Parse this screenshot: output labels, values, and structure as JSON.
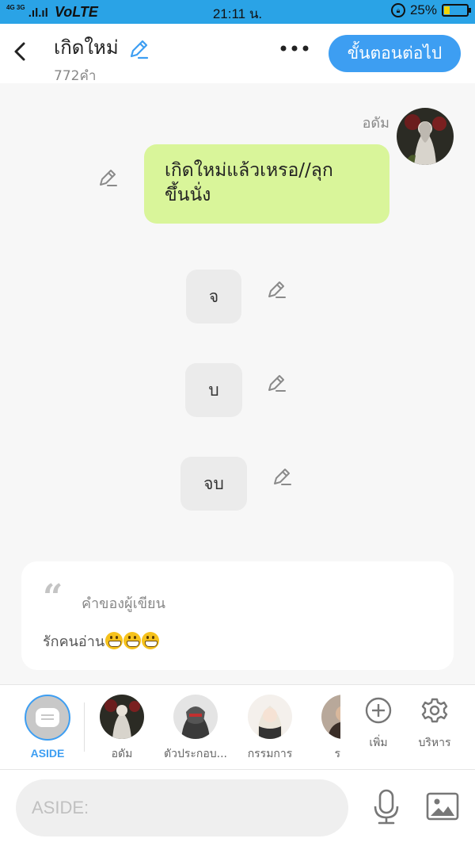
{
  "status_bar": {
    "network": "4G 3G",
    "carrier": "VoLTE",
    "time": "21:11 น.",
    "battery": "25%",
    "battery_level": 0.25
  },
  "header": {
    "title": "เกิดใหม่",
    "word_count": "772คำ",
    "next_button": "ขั้นตอนต่อไป"
  },
  "messages": [
    {
      "sender": "อดัม",
      "text_line1": "เกิดใหม่แล้วเหรอ//ลุก",
      "text_line2": "ขึ้นนั่ง"
    },
    {
      "text": "จ"
    },
    {
      "text": "บ"
    },
    {
      "text": "จบ"
    }
  ],
  "author_note": {
    "title": "คำของผู้เขียน",
    "body": "รักคนอ่าน"
  },
  "characters": [
    {
      "label": "ASIDE"
    },
    {
      "label": "อดัม"
    },
    {
      "label": "ตัวประกอบ..."
    },
    {
      "label": "กรรมการ"
    },
    {
      "label": "ร"
    }
  ],
  "tools": {
    "add_label": "เพิ่ม",
    "manage_label": "บริหาร"
  },
  "input": {
    "placeholder": "ASIDE:"
  },
  "colors": {
    "status_bar": "#2aa3e6",
    "accent": "#3d9ef2",
    "green_bubble": "#d9f59a"
  }
}
